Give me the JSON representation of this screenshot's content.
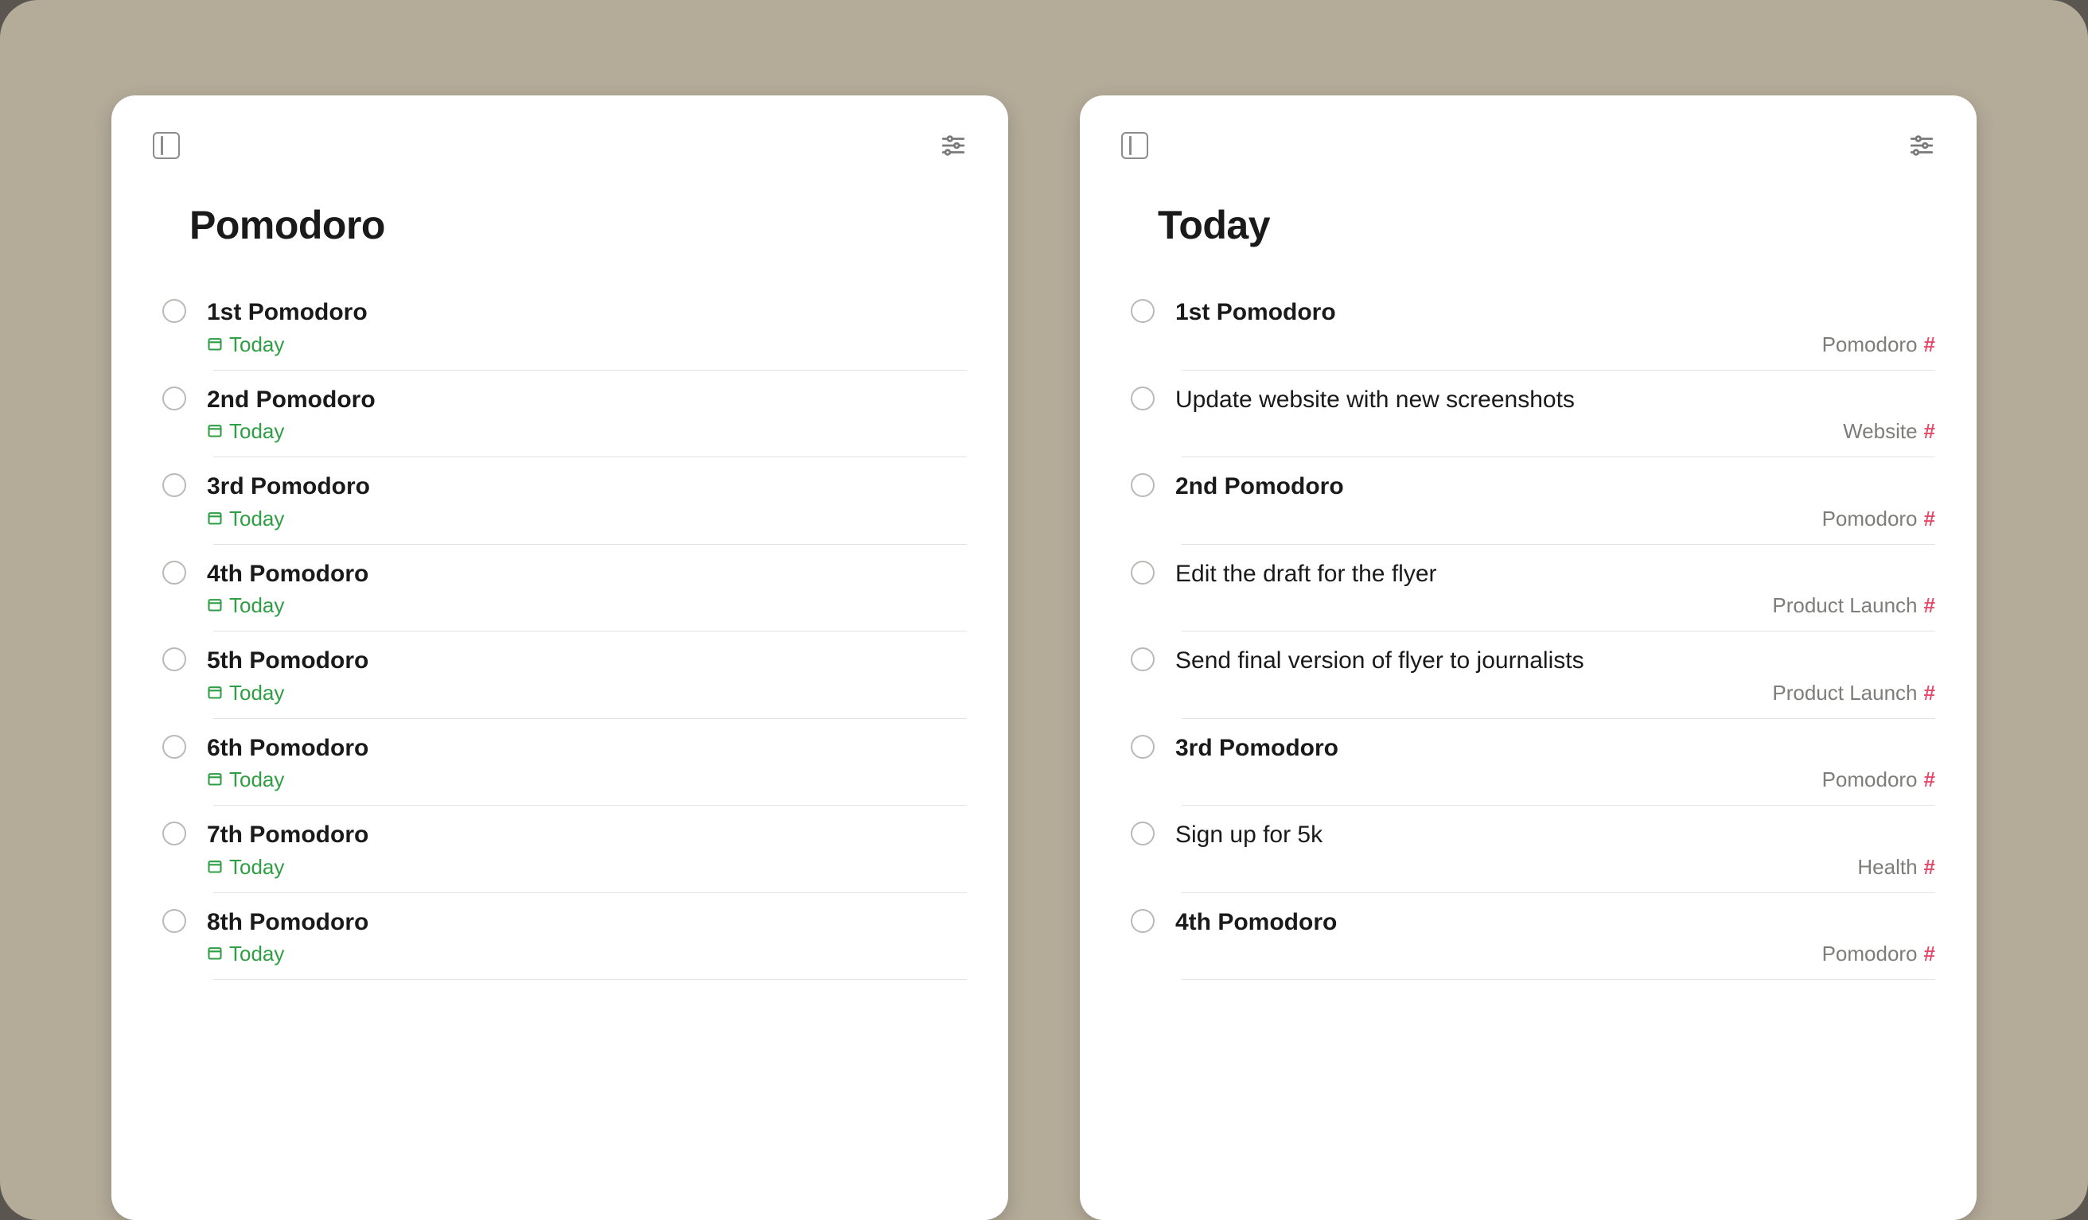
{
  "left": {
    "title": "Pomodoro",
    "date_label": "Today",
    "items": [
      {
        "title": "1st Pomodoro",
        "bold": true
      },
      {
        "title": "2nd Pomodoro",
        "bold": true
      },
      {
        "title": "3rd Pomodoro",
        "bold": true
      },
      {
        "title": "4th Pomodoro",
        "bold": true
      },
      {
        "title": "5th Pomodoro",
        "bold": true
      },
      {
        "title": "6th Pomodoro",
        "bold": true
      },
      {
        "title": "7th Pomodoro",
        "bold": true
      },
      {
        "title": "8th Pomodoro",
        "bold": true
      }
    ]
  },
  "right": {
    "title": "Today",
    "items": [
      {
        "title": "1st Pomodoro",
        "bold": true,
        "project": "Pomodoro"
      },
      {
        "title": "Update website with new screenshots",
        "bold": false,
        "project": "Website"
      },
      {
        "title": "2nd Pomodoro",
        "bold": true,
        "project": "Pomodoro"
      },
      {
        "title": "Edit the draft for the flyer",
        "bold": false,
        "project": "Product Launch"
      },
      {
        "title": "Send final version of flyer to journalists",
        "bold": false,
        "project": "Product Launch"
      },
      {
        "title": "3rd Pomodoro",
        "bold": true,
        "project": "Pomodoro"
      },
      {
        "title": "Sign up for 5k",
        "bold": false,
        "project": "Health"
      },
      {
        "title": "4th Pomodoro",
        "bold": true,
        "project": "Pomodoro"
      }
    ]
  }
}
